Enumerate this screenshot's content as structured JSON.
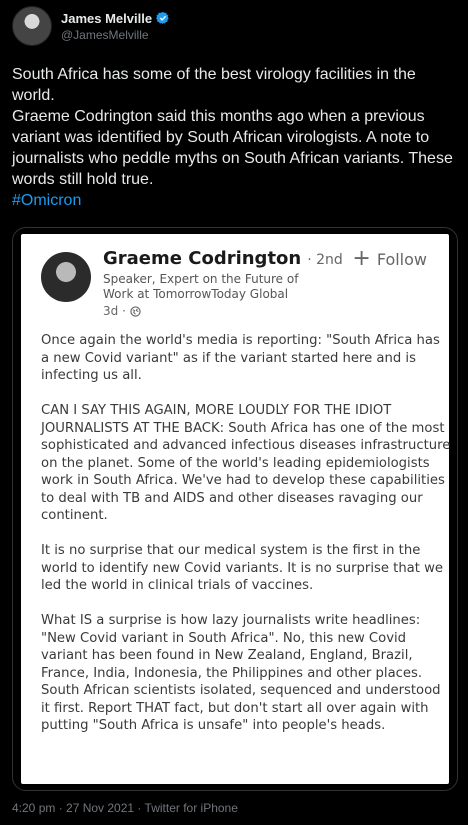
{
  "tweet": {
    "author_name": "James Melville",
    "author_handle": "@JamesMelville",
    "text": "South Africa has some of the best virology facilities in the world.\nGraeme Codrington said this months ago when a previous variant was identified by South African virologists. A note to journalists who peddle myths on South African variants. These words still hold true.",
    "hashtag": "#Omicron",
    "footer": "4:20 pm · 27 Nov 2021 · Twitter for iPhone"
  },
  "embed": {
    "name": "Graeme Codrington",
    "degree": "· 2nd",
    "headline": "Speaker, Expert on the Future of Work at TomorrowToday Global",
    "time": "3d ·",
    "follow_label": "Follow",
    "paragraphs": [
      "Once again the world's media is reporting: \"South Africa has a new Covid variant\" as if the variant started here and is infecting us all.",
      "CAN I SAY THIS AGAIN, MORE LOUDLY FOR THE IDIOT JOURNALISTS AT THE BACK: South Africa has one of the most sophisticated and advanced infectious diseases infrastructure on the planet. Some of the world's leading epidemiologists work in South Africa. We've had to develop these capabilities to deal with TB and AIDS and other diseases ravaging our continent.",
      "It is no surprise that our medical system is the first in the world to identify new Covid variants. It is no surprise that we led the world in clinical trials of vaccines.",
      "What IS a surprise is how lazy journalists write headlines: \"New Covid variant in South Africa\". No, this new Covid variant has been found in New Zealand, England, Brazil, France, India, Indonesia, the Philippines and other places. South African scientists isolated, sequenced and understood it first. Report THAT fact, but don't start all over again with putting \"South Africa is unsafe\" into people's heads."
    ]
  },
  "colors": {
    "background": "#000000",
    "text": "#e7e9ea",
    "secondary": "#71767b",
    "link": "#1d9bf0",
    "verified": "#1d9bf0"
  },
  "icons": [
    "verified-badge-icon",
    "globe-icon",
    "plus-icon"
  ]
}
